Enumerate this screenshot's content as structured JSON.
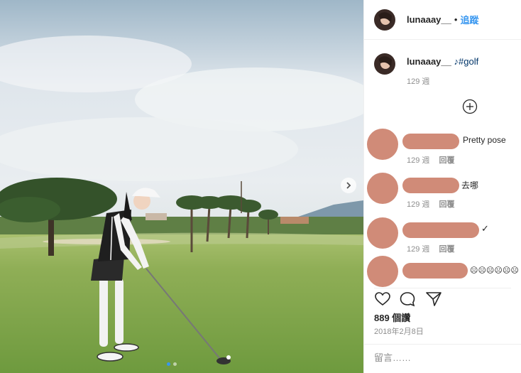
{
  "post": {
    "username": "lunaaay__",
    "follow_label": "追蹤",
    "caption_text": "♪#golf",
    "caption_time": "129 週",
    "likes": "889 個讚",
    "date": "2018年2月8日",
    "comment_placeholder": "留言……"
  },
  "comments": [
    {
      "text": "Pretty pose",
      "time": "129 週",
      "reply": "回覆"
    },
    {
      "text": "去哪",
      "time": "129 週",
      "reply": "回覆"
    },
    {
      "text": "✓",
      "time": "129 週",
      "reply": "回覆"
    },
    {
      "text": "☹☹☹☹☹☹"
    }
  ],
  "colors": {
    "accent": "#3897f0",
    "redaction": "#d08b78",
    "muted": "#8e8e8e"
  },
  "icons": [
    "next-arrow-icon",
    "load-more-comments-icon",
    "heart-icon",
    "comment-bubble-icon",
    "share-icon"
  ]
}
